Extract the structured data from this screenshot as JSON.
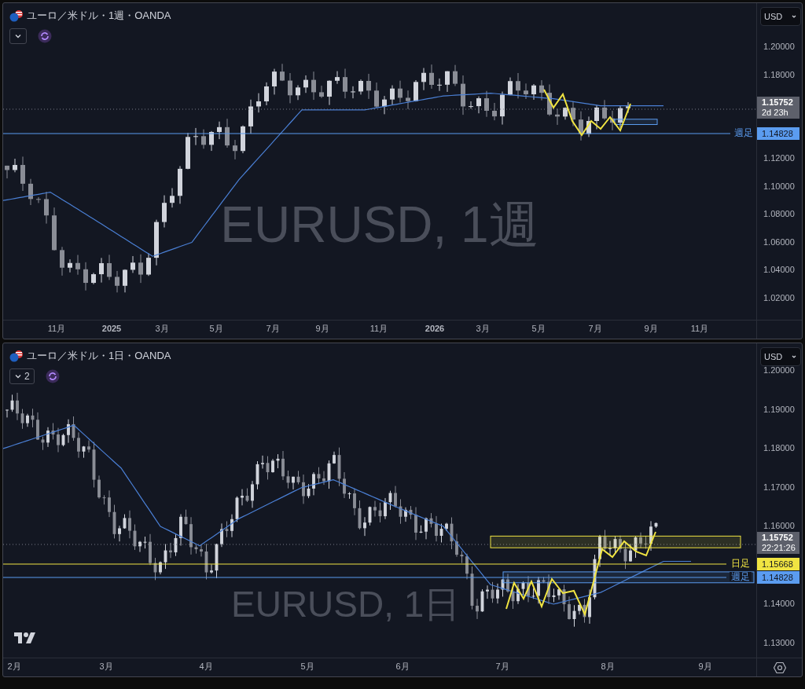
{
  "panes": [
    {
      "title": "ユーロ／米ドル・1週・OANDA",
      "currency": "USD",
      "watermark": "EURUSD, 1週",
      "price_ticks": [
        "1.20000",
        "1.18000",
        "1.12000",
        "1.10000",
        "1.08000",
        "1.06000",
        "1.04000",
        "1.02000"
      ],
      "time_ticks": [
        {
          "label": "11月",
          "kind": "month"
        },
        {
          "label": "2025",
          "kind": "year"
        },
        {
          "label": "3月",
          "kind": "month"
        },
        {
          "label": "5月",
          "kind": "month"
        },
        {
          "label": "7月",
          "kind": "month"
        },
        {
          "label": "9月",
          "kind": "month"
        },
        {
          "label": "11月",
          "kind": "month"
        },
        {
          "label": "2026",
          "kind": "year"
        },
        {
          "label": "3月",
          "kind": "month"
        },
        {
          "label": "5月",
          "kind": "month"
        },
        {
          "label": "7月",
          "kind": "month"
        },
        {
          "label": "9月",
          "kind": "month"
        },
        {
          "label": "11月",
          "kind": "month"
        }
      ],
      "last_price": {
        "price": "1.15752",
        "countdown": "2d 23h"
      },
      "levels": [
        {
          "label": "週足",
          "price": "1.14828",
          "color": "#5b9cf0"
        }
      ]
    },
    {
      "title": "ユーロ／米ドル・1日・OANDA",
      "indicator_count": "2",
      "currency": "USD",
      "watermark": "EURUSD, 1日",
      "price_ticks": [
        "1.20000",
        "1.19000",
        "1.18000",
        "1.17000",
        "1.16000",
        "1.14000",
        "1.13000"
      ],
      "time_ticks": [
        {
          "label": "2月",
          "kind": "month"
        },
        {
          "label": "3月",
          "kind": "month"
        },
        {
          "label": "4月",
          "kind": "month"
        },
        {
          "label": "5月",
          "kind": "month"
        },
        {
          "label": "6月",
          "kind": "month"
        },
        {
          "label": "7月",
          "kind": "month"
        },
        {
          "label": "8月",
          "kind": "month"
        },
        {
          "label": "9月",
          "kind": "month"
        }
      ],
      "last_price": {
        "price": "1.15752",
        "countdown": "22:21:26"
      },
      "levels": [
        {
          "label": "日足",
          "price": "1.15668",
          "color": "#f0e442"
        },
        {
          "label": "週足",
          "price": "1.14828",
          "color": "#5b9cf0"
        }
      ]
    }
  ]
}
